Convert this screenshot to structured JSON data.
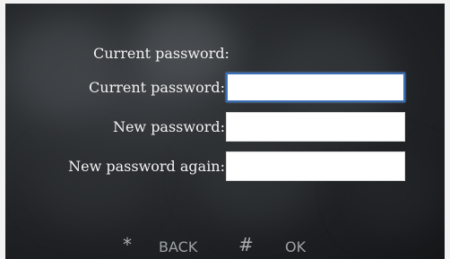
{
  "heading": "Current password:",
  "fields": [
    {
      "label": "Current password:",
      "value": "",
      "focused": true
    },
    {
      "label": "New password:",
      "value": ""
    },
    {
      "label": "New password again:",
      "value": ""
    }
  ],
  "footer": {
    "back_key_icon": "*",
    "back_label": "BACK",
    "ok_key_icon": "#",
    "ok_label": "OK"
  },
  "colors": {
    "text": "#f2f2f2",
    "input_bg": "#ffffff",
    "focus_border": "#3d6fb6",
    "footer_text": "#9ea3a7"
  },
  "icons": {
    "back_key": "asterisk-key-icon",
    "ok_key": "hash-key-icon"
  }
}
